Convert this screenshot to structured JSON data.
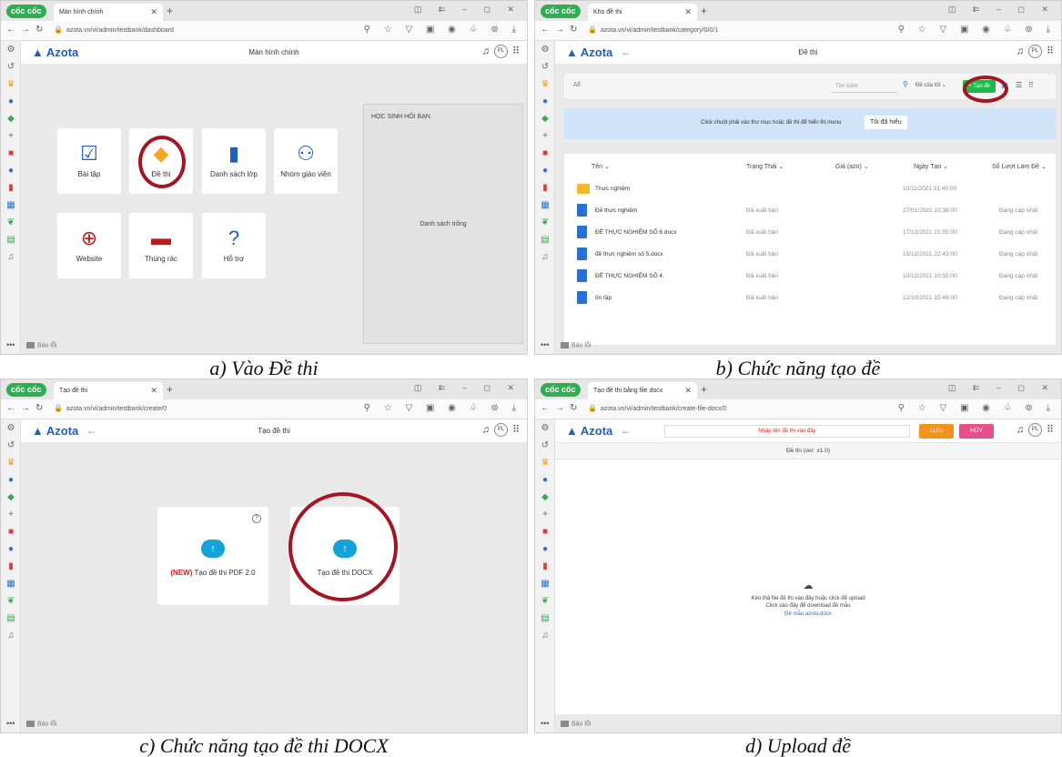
{
  "captions": {
    "a": "a) Vào Đề thi",
    "b": "b) Chức năng tạo đề",
    "c": "c) Chức năng tạo đề thi DOCX",
    "d": "d) Upload đề"
  },
  "browser": {
    "brand": "cốc cốc",
    "avatar_initials": "PL",
    "report_label": "Báo lỗi",
    "app_brand": "Azota"
  },
  "panel_a": {
    "tab_title": "Màn hình chính",
    "url": "azota.vn/vi/admin/testbank/dashboard",
    "page_title": "Màn hình chính",
    "cards": [
      "Bài tập",
      "Đề thi",
      "Danh sách lớp",
      "Nhóm giáo viên",
      "Website",
      "Thùng rác",
      "Hỗ trợ"
    ],
    "side_title": "HỌC SINH HỎI BẠN",
    "side_empty": "Danh sách trống"
  },
  "panel_b": {
    "tab_title": "Kho đề thi",
    "url": "azota.vn/vi/admin/testbank/category/0/0/1",
    "page_title": "Đề thi",
    "filter_all": "All",
    "search_placeholder": "Tìm kiếm",
    "owner_filter": "Đề của tôi",
    "create_button": "+ Tạo đề",
    "info_text": "Click chuột phải vào thư mục hoặc đề thi để hiển thị menu",
    "understood_button": "Tôi đã hiểu",
    "columns": [
      "Tên",
      "Trạng Thái",
      "Giá (azo)",
      "Ngày Tạo",
      "Số Lượt Làm Đề"
    ],
    "rows": [
      {
        "name": "Thực nghiệm",
        "status": "",
        "date": "10/11/2021 21:40:00",
        "count": ""
      },
      {
        "name": "Đề thực nghiệm",
        "status": "Đã xuất bản",
        "date": "27/01/2022 10:38:00",
        "count": "Đang cập nhật"
      },
      {
        "name": "ĐỀ THỰC NGHIỆM SỐ 6.docx",
        "status": "Đã xuất bản",
        "date": "17/12/2021 21:55:00",
        "count": "Đang cập nhật"
      },
      {
        "name": "đề thực nghiệm số 5.docx",
        "status": "Đã xuất bản",
        "date": "15/12/2021 22:43:00",
        "count": "Đang cập nhật"
      },
      {
        "name": "ĐỀ THỰC NGHIỆM SỐ 4.",
        "status": "Đã xuất bản",
        "date": "10/12/2021 10:55:00",
        "count": "Đang cập nhật"
      },
      {
        "name": "ôn tập",
        "status": "Đã xuất bản",
        "date": "12/10/2021 15:46:00",
        "count": "Đang cập nhật"
      }
    ]
  },
  "panel_c": {
    "tab_title": "Tạo đề thi",
    "url": "azota.vn/vi/admin/testbank/create/0",
    "page_title": "Tạo đề thi",
    "pdf_new_tag": "(NEW)",
    "pdf_label": "Tạo đề thi PDF 2.0",
    "docx_label": "Tạo đề thi DOCX"
  },
  "panel_d": {
    "tab_title": "Tạo đề thi bằng file docx",
    "url": "azota.vn/vi/admin/testbank/create-file-docx/0",
    "title_placeholder": "Nhập tên đề thi vào đây",
    "save_button": "LƯU",
    "cancel_button": "HỦY",
    "version": "Đề thi (ver: x1.0)",
    "upload_line1": "Kéo thả file đề thi vào đây hoặc click để upload",
    "upload_line2": "Click vào đây để download đề mẫu",
    "upload_link": "Đề mẫu azota.docx"
  },
  "colors": {
    "highlight_ring": "#a31621",
    "create_green": "#1db94a",
    "save_orange": "#f5921e",
    "cancel_pink": "#e84e8a",
    "brand_blue": "#1f5fb8"
  }
}
